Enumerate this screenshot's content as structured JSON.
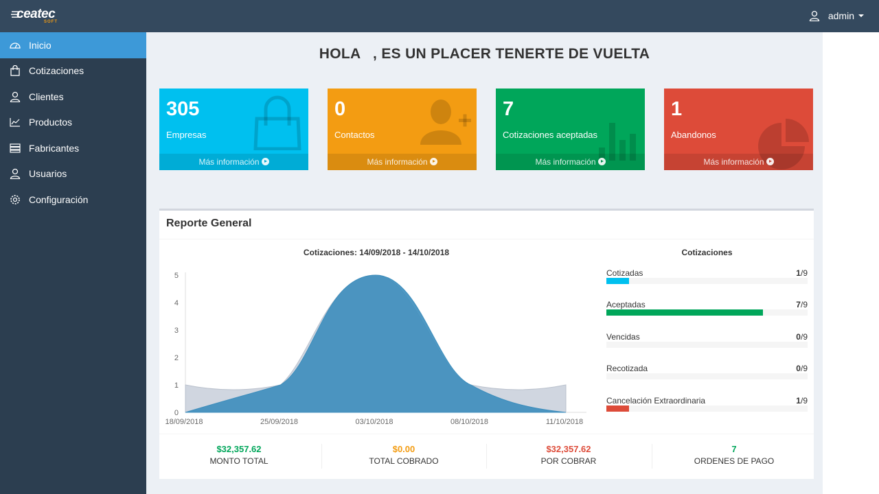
{
  "app": {
    "logo_text": "ceatec",
    "logo_sub": "SOFT"
  },
  "header": {
    "user": "admin"
  },
  "sidebar": {
    "items": [
      {
        "label": "Inicio",
        "icon": "dashboard-icon",
        "active": true
      },
      {
        "label": "Cotizaciones",
        "icon": "shopping-bag-icon",
        "active": false
      },
      {
        "label": "Clientes",
        "icon": "user-icon",
        "active": false
      },
      {
        "label": "Productos",
        "icon": "line-chart-icon",
        "active": false
      },
      {
        "label": "Fabricantes",
        "icon": "server-icon",
        "active": false
      },
      {
        "label": "Usuarios",
        "icon": "user-icon",
        "active": false
      },
      {
        "label": "Configuración",
        "icon": "gear-icon",
        "active": false
      }
    ]
  },
  "greeting": "HOLA   , ES UN PLACER TENERTE DE VUELTA",
  "stats": [
    {
      "value": "305",
      "label": "Empresas",
      "link": "Más información",
      "color": "#00c0ef",
      "icon": "shopping-bag-icon"
    },
    {
      "value": "0",
      "label": "Contactos",
      "link": "Más información",
      "color": "#f39c12",
      "icon": "user-add-icon"
    },
    {
      "value": "7",
      "label": "Cotizaciones aceptadas",
      "link": "Más información",
      "color": "#00a65a",
      "icon": "bar-chart-icon"
    },
    {
      "value": "1",
      "label": "Abandonos",
      "link": "Más información",
      "color": "#dd4b39",
      "icon": "pie-chart-icon"
    }
  ],
  "report": {
    "title": "Reporte General",
    "chart_title": "Cotizaciones: 14/09/2018 - 14/10/2018",
    "progress_title": "Cotizaciones",
    "progress": [
      {
        "name": "Cotizadas",
        "value": "1",
        "total": "/9",
        "fraction": 0.111,
        "color": "#00c0ef"
      },
      {
        "name": "Aceptadas",
        "value": "7",
        "total": "/9",
        "fraction": 0.778,
        "color": "#00a65a"
      },
      {
        "name": "Vencidas",
        "value": "0",
        "total": "/9",
        "fraction": 0,
        "color": "#f39c12"
      },
      {
        "name": "Recotizada",
        "value": "0",
        "total": "/9",
        "fraction": 0,
        "color": "#3c8dbc"
      },
      {
        "name": "Cancelación Extraordinaria",
        "value": "1",
        "total": "/9",
        "fraction": 0.111,
        "color": "#dd4b39"
      }
    ],
    "descriptions": [
      {
        "amount": "$32,357.62",
        "label": "MONTO TOTAL",
        "color": "#00a65a"
      },
      {
        "amount": "$0.00",
        "label": "TOTAL COBRADO",
        "color": "#f39c12"
      },
      {
        "amount": "$32,357.62",
        "label": "POR COBRAR",
        "color": "#dd4b39"
      },
      {
        "amount": "7",
        "label": "ORDENES DE PAGO",
        "color": "#00a65a"
      }
    ]
  },
  "chart_data": {
    "type": "area",
    "title": "Cotizaciones: 14/09/2018 - 14/10/2018",
    "xlabel": "",
    "ylabel": "",
    "x_ticks": [
      "18/09/2018",
      "25/09/2018",
      "03/10/2018",
      "08/10/2018",
      "11/10/2018"
    ],
    "ylim": [
      0,
      5
    ],
    "y_ticks": [
      0,
      1,
      2,
      3,
      4,
      5
    ],
    "grid": false,
    "series": [
      {
        "values": [
          1,
          1,
          5,
          1,
          1
        ],
        "color": "#c8cfda",
        "curve": "bezier"
      },
      {
        "values": [
          0,
          1,
          5,
          1,
          0
        ],
        "color": "#3c8dbc",
        "curve": "smooth"
      }
    ]
  }
}
